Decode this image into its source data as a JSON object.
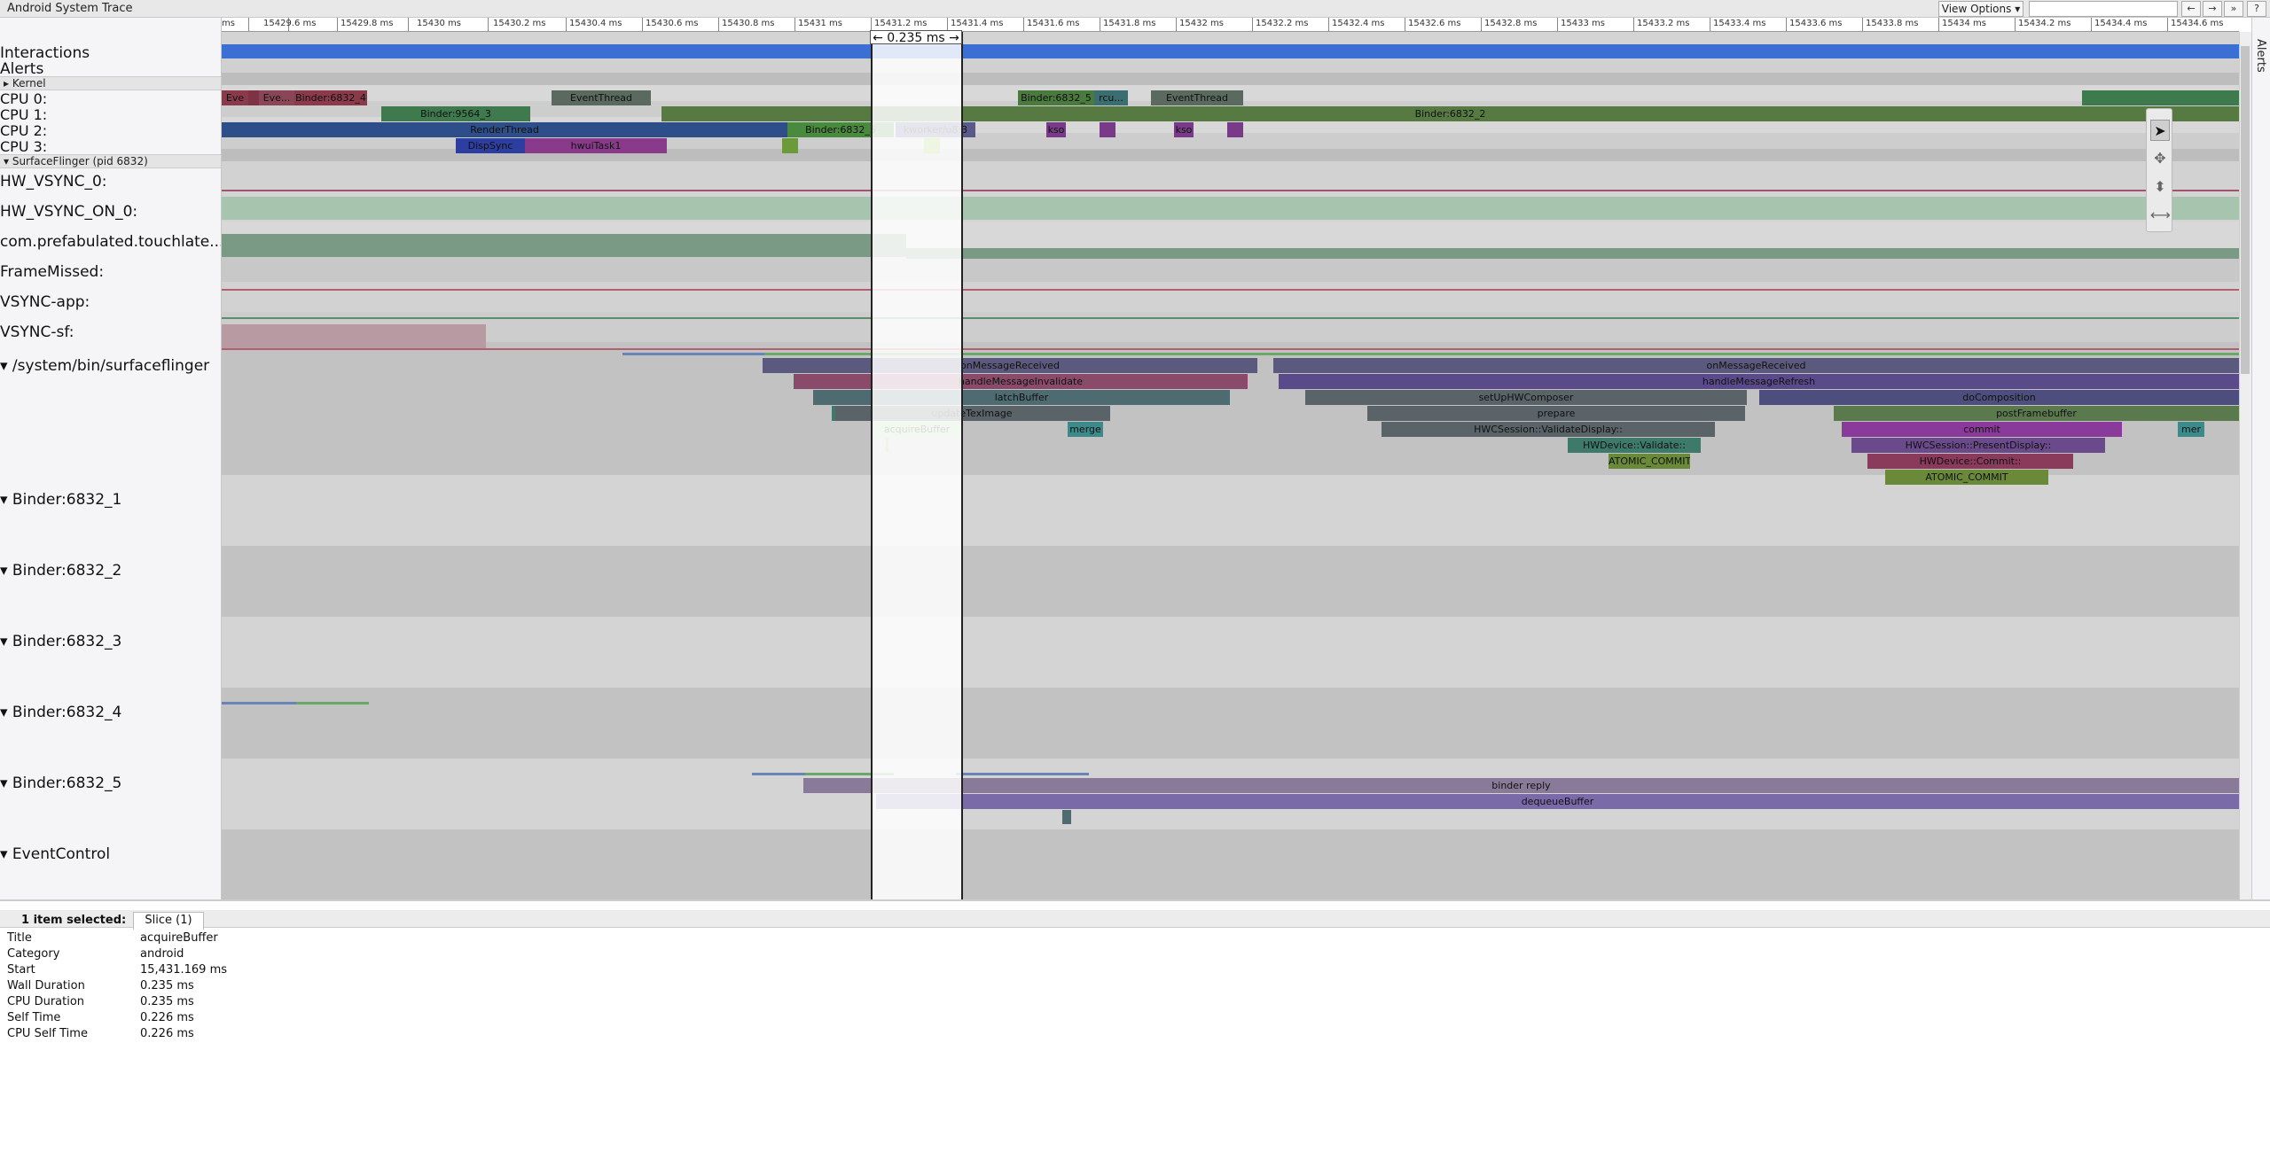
{
  "app": {
    "title": "Android System Trace"
  },
  "toolbar": {
    "view_options": "View Options ▾",
    "search_placeholder": "",
    "prev": "←",
    "next": "→",
    "skip": "»",
    "help": "?"
  },
  "ruler": {
    "ticks": [
      "ms",
      "15429.6 ms",
      "15429.8 ms",
      "15430 ms",
      "15430.2 ms",
      "15430.4 ms",
      "15430.6 ms",
      "15430.8 ms",
      "15431 ms",
      "15431.2 ms",
      "15431.4 ms",
      "15431.6 ms",
      "15431.8 ms",
      "15432 ms",
      "15432.2 ms",
      "15432.4 ms",
      "15432.6 ms",
      "15432.8 ms",
      "15433 ms",
      "15433.2 ms",
      "15433.4 ms",
      "15433.6 ms",
      "15433.8 ms",
      "15434 ms",
      "15434.2 ms",
      "15434.4 ms",
      "15434.6 ms"
    ],
    "selection_duration": "← 0.235 ms →"
  },
  "tracks": {
    "interactions": "Interactions",
    "alerts": "Alerts",
    "kernel": "▸ Kernel",
    "cpu0": "CPU 0:",
    "cpu1": "CPU 1:",
    "cpu2": "CPU 2:",
    "cpu3": "CPU 3:",
    "surfaceflinger_pid": "▾ SurfaceFlinger (pid 6832)",
    "hw_vsync": "HW_VSYNC_0:",
    "hw_vsync_on": "HW_VSYNC_ON_0:",
    "touchlate": "com.prefabulated.touchlate...",
    "frame_missed": "FrameMissed:",
    "vsync_app": "VSYNC-app:",
    "vsync_sf": "VSYNC-sf:",
    "system_bin_sf": "▾  /system/bin/surfaceflinger",
    "binder1": "▾  Binder:6832_1",
    "binder2": "▾  Binder:6832_2",
    "binder3": "▾  Binder:6832_3",
    "binder4": "▾  Binder:6832_4",
    "binder5": "▾  Binder:6832_5",
    "eventcontrol": "▾  EventControl"
  },
  "slices": {
    "cpu0_a": "Eve",
    "cpu0_b": "Eve...",
    "cpu0_c": "Binder:6832_4",
    "cpu0_d": "EventThread",
    "cpu0_e": "Binder:6832_5",
    "cpu0_f": "rcu...",
    "cpu0_g": "EventThread",
    "cpu1_a": "Binder:9564_3",
    "cpu1_b": "Binder:6832_2",
    "cpu2_a": "RenderThread",
    "cpu2_b": "Binder:6832_5",
    "cpu2_c": "kworker/u8:3",
    "cpu2_d": "kso",
    "cpu2_e": "kso",
    "cpu3_a": "DispSync",
    "cpu3_b": "hwuiTask1",
    "sf1": "onMessageReceived",
    "sf2": "handleMessageInvalidate",
    "sf3": "latchBuffer",
    "sf4": "updateTexImage",
    "sf5": "acquireBuffer",
    "sf6": "merge",
    "sf7": "onMessageReceived",
    "sf8": "handleMessageRefresh",
    "sf9": "setUpHWComposer",
    "sf10": "doComposition",
    "sf11": "prepare",
    "sf12": "postFramebuffer",
    "sf13": "HWCSession::ValidateDisplay::",
    "sf14": "commit",
    "sf15": "mer",
    "sf16": "HWDevice::Validate::",
    "sf17": "HWCSession::PresentDisplay::",
    "sf18": "ATOMIC_COMMIT",
    "sf19": "HWDevice::Commit::",
    "sf20": "ATOMIC_COMMIT",
    "b5_a": "binder reply",
    "b5_b": "dequeueBuffer"
  },
  "details": {
    "selected": "1 item selected:",
    "tab": "Slice (1)",
    "rows": [
      {
        "key": "Title",
        "value": "acquireBuffer"
      },
      {
        "key": "Category",
        "value": "android"
      },
      {
        "key": "Start",
        "value": "15,431.169 ms"
      },
      {
        "key": "Wall Duration",
        "value": "0.235 ms"
      },
      {
        "key": "CPU Duration",
        "value": "0.235 ms"
      },
      {
        "key": "Self Time",
        "value": "0.226 ms"
      },
      {
        "key": "CPU Self Time",
        "value": "0.226 ms"
      }
    ]
  },
  "side": {
    "alerts": "Alerts"
  },
  "tools": {
    "select": "➤",
    "pan": "✥",
    "zoom": "⬍",
    "timing": "⟷"
  },
  "colors": {
    "interactions_bar": "#3b6fd4",
    "highlight": "#ffffff"
  }
}
